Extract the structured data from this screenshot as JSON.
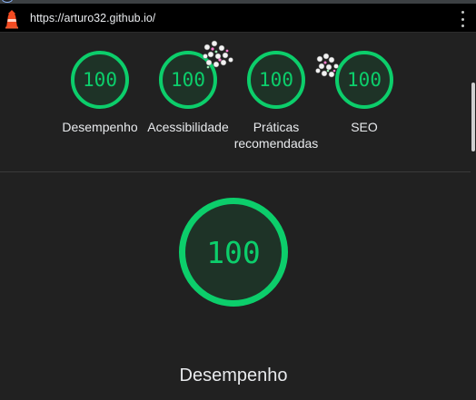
{
  "browser": {
    "url": "https://arturo32.github.io/",
    "menu_icon": "more-vert-icon",
    "site_icon": "lighthouse-icon"
  },
  "colors": {
    "pass": "#0cce6b",
    "pass_fill": "#1e3327",
    "background": "#212121"
  },
  "gauges": [
    {
      "score": "100",
      "label": "Desempenho"
    },
    {
      "score": "100",
      "label": "Acessibilidade"
    },
    {
      "score": "100",
      "label": "Práticas recomendadas"
    },
    {
      "score": "100",
      "label": "SEO"
    }
  ],
  "main_gauge": {
    "score": "100",
    "label": "Desempenho"
  }
}
